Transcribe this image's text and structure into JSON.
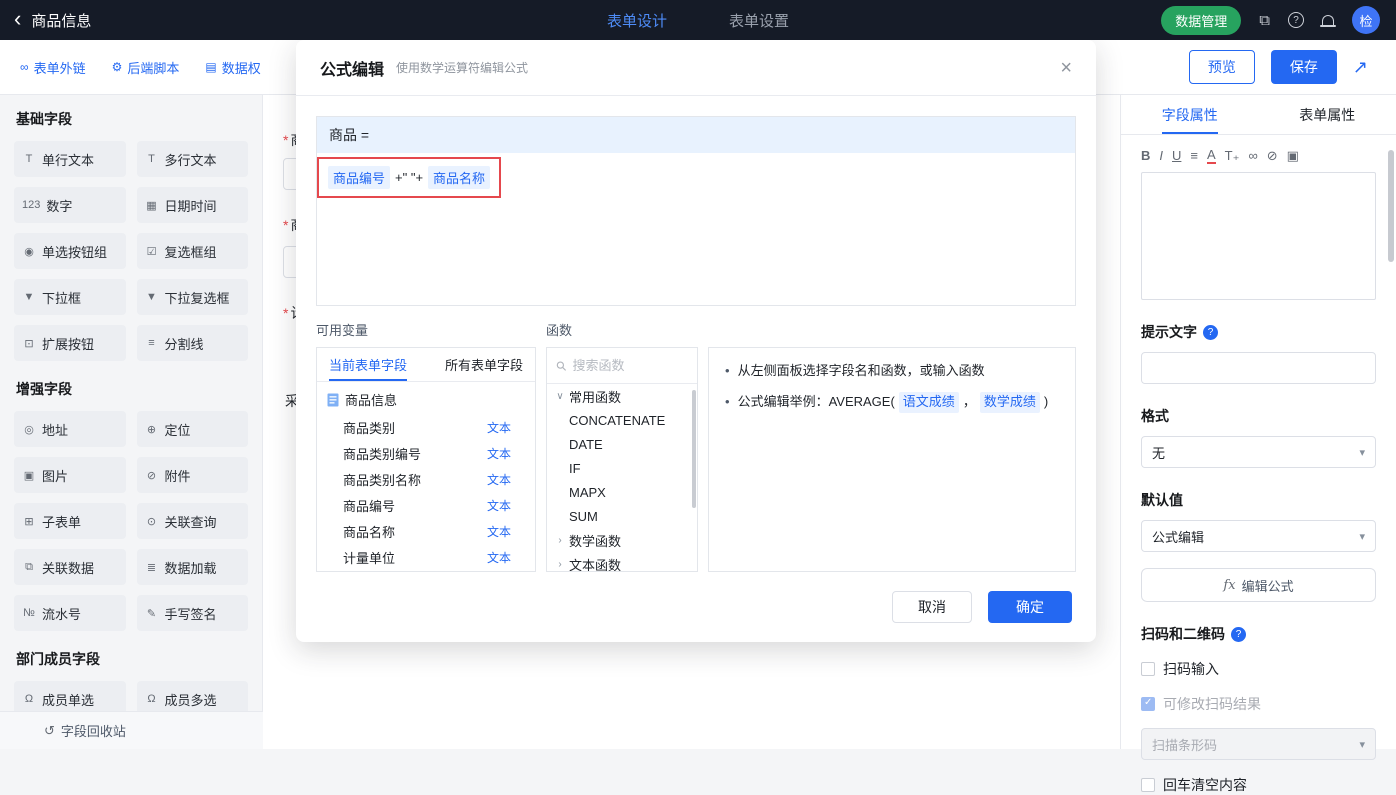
{
  "colors": {
    "topbar_bg": "#151b27",
    "accent_blue": "#2468f2",
    "green": "#27a35f",
    "highlight_red": "#e5484d",
    "formula_bar_bg": "#e8f2fe"
  },
  "topbar": {
    "title": "商品信息",
    "tabs": [
      {
        "label": "表单设计"
      },
      {
        "label": "表单设置"
      }
    ],
    "data_manage": "数据管理",
    "avatar": "检"
  },
  "header_row": {
    "links": [
      {
        "icon": "∞",
        "label": "表单外链"
      },
      {
        "icon": "⚙",
        "label": "后端脚本"
      },
      {
        "icon": "▤",
        "label": "数据权"
      }
    ],
    "preview": "预览",
    "save": "保存",
    "share_icon": "↗"
  },
  "sidebar": {
    "sections": [
      {
        "title": "基础字段",
        "items": [
          {
            "icon": "T",
            "label": "单行文本"
          },
          {
            "icon": "T",
            "label": "多行文本"
          },
          {
            "icon": "123",
            "label": "数字"
          },
          {
            "icon": "▦",
            "label": "日期时间"
          },
          {
            "icon": "◉",
            "label": "单选按钮组"
          },
          {
            "icon": "☑",
            "label": "复选框组"
          },
          {
            "icon": "▼",
            "label": "下拉框"
          },
          {
            "icon": "▼",
            "label": "下拉复选框"
          },
          {
            "icon": "⊡",
            "label": "扩展按钮"
          },
          {
            "icon": "≡",
            "label": "分割线"
          }
        ]
      },
      {
        "title": "增强字段",
        "items": [
          {
            "icon": "◎",
            "label": "地址"
          },
          {
            "icon": "⊕",
            "label": "定位"
          },
          {
            "icon": "▣",
            "label": "图片"
          },
          {
            "icon": "⊘",
            "label": "附件"
          },
          {
            "icon": "⊞",
            "label": "子表单"
          },
          {
            "icon": "⊙",
            "label": "关联查询"
          },
          {
            "icon": "⧉",
            "label": "关联数据"
          },
          {
            "icon": "≣",
            "label": "数据加载"
          },
          {
            "icon": "№",
            "label": "流水号"
          },
          {
            "icon": "✎",
            "label": "手写签名"
          }
        ]
      },
      {
        "title": "部门成员字段",
        "items": [
          {
            "icon": "Ω",
            "label": "成员单选"
          },
          {
            "icon": "Ω",
            "label": "成员多选"
          }
        ]
      }
    ],
    "recycle": {
      "icon": "↺",
      "label": "字段回收站"
    }
  },
  "canvas": {
    "fragments": [
      {
        "star": "*",
        "text": "商"
      },
      {
        "star": "*",
        "text": "商"
      },
      {
        "star": "*",
        "text": "计"
      },
      {
        "star": "",
        "text": "采"
      }
    ]
  },
  "modal": {
    "title": "公式编辑",
    "subtitle": "使用数学运算符编辑公式",
    "close_icon": "×",
    "target": "商品 =",
    "formula": {
      "token1": "商品编号",
      "op": "+\" \"+",
      "token2": "商品名称"
    },
    "variables": {
      "label": "可用变量",
      "tab_current": "当前表单字段",
      "tab_all": "所有表单字段",
      "root": "商品信息",
      "fields": [
        {
          "name": "商品类别",
          "type": "文本"
        },
        {
          "name": "商品类别编号",
          "type": "文本"
        },
        {
          "name": "商品类别名称",
          "type": "文本"
        },
        {
          "name": "商品编号",
          "type": "文本"
        },
        {
          "name": "商品名称",
          "type": "文本"
        },
        {
          "name": "计量单位",
          "type": "文本"
        }
      ]
    },
    "functions": {
      "label": "函数",
      "search_placeholder": "搜索函数",
      "group_common": "常用函数",
      "items": [
        "CONCATENATE",
        "DATE",
        "IF",
        "MAPX",
        "SUM"
      ],
      "group_math": "数学函数",
      "group_text": "文本函数"
    },
    "help": {
      "line1": "从左侧面板选择字段名和函数，或输入函数",
      "line2_prefix": "公式编辑举例：AVERAGE(",
      "arg1": "语文成绩",
      "sep": "，",
      "arg2": "数学成绩",
      "suffix": ")"
    },
    "cancel": "取消",
    "ok": "确定"
  },
  "right_panel": {
    "tab_field": "字段属性",
    "tab_form": "表单属性",
    "rich_icons": [
      "B",
      "I",
      "U",
      "≡",
      "A",
      "T₊",
      "∞",
      "⊘",
      "▣"
    ],
    "hint_label": "提示文字",
    "format_label": "格式",
    "format_value": "无",
    "default_label": "默认值",
    "default_value": "公式编辑",
    "edit_formula": "编辑公式",
    "scan_label": "扫码和二维码",
    "cb_scan": "扫码输入",
    "cb_modify": "可修改扫码结果",
    "scan_select": "扫描条形码",
    "cb_enter_clear": "回车清空内容"
  }
}
